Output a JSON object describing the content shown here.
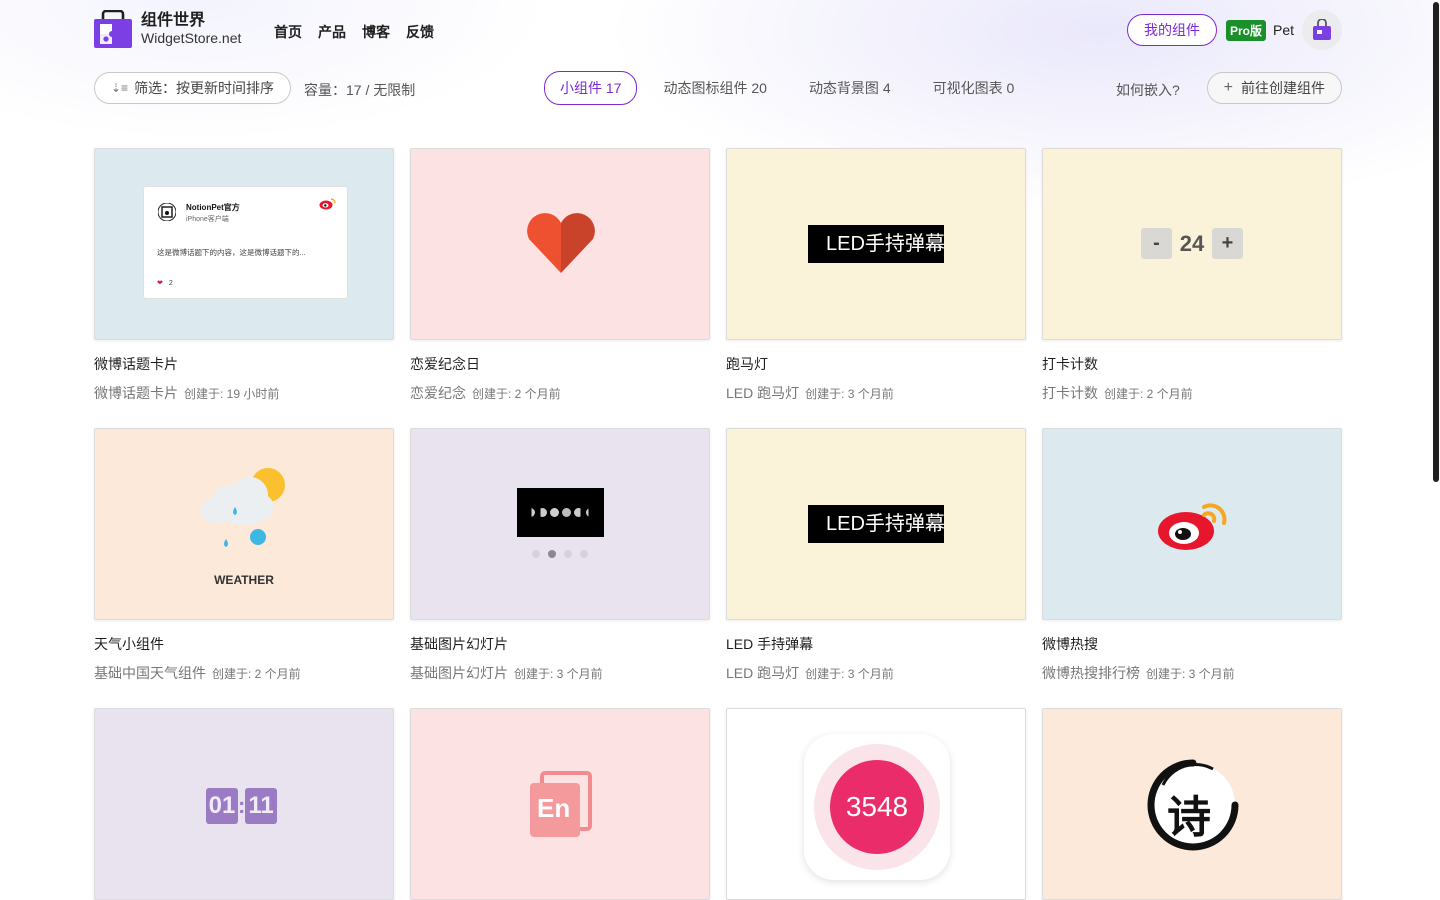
{
  "brand": {
    "title": "组件世界",
    "subtitle": "WidgetStore.net"
  },
  "nav": [
    "首页",
    "产品",
    "博客",
    "反馈"
  ],
  "header_right": {
    "my_widgets": "我的组件",
    "pro_badge": "Pro版",
    "user_name": "Pet"
  },
  "toolbar": {
    "filter_label": "筛选：按更新时间排序",
    "capacity": "容量：17 / 无限制",
    "tabs": [
      "小组件 17",
      "动态图标组件 20",
      "动态背景图 4",
      "可视化图表 0"
    ],
    "active_tab": "小组件 17",
    "embed_help": "如何嵌入?",
    "create_button": "前往创建组件"
  },
  "colors": {
    "accent": "#7b2ad6",
    "pro_green": "#1a8f2a"
  },
  "cards": [
    {
      "title": "微博话题卡片",
      "category": "微博话题卡片",
      "created": "创建于: 19 小时前",
      "preview": {
        "account": "NotionPet官方",
        "client": "iPhone客户端",
        "text": "这是微博话题下的内容，这是微博话题下的...",
        "likes": "2"
      }
    },
    {
      "title": "恋爱纪念日",
      "category": "恋爱纪念",
      "created": "创建于: 2 个月前"
    },
    {
      "title": "跑马灯",
      "category": "LED 跑马灯",
      "created": "创建于: 3 个月前",
      "preview": {
        "led_text": "LED手持弹幕"
      }
    },
    {
      "title": "打卡计数",
      "category": "打卡计数",
      "created": "创建于: 2 个月前",
      "preview": {
        "minus": "-",
        "value": "24",
        "plus": "+"
      }
    },
    {
      "title": "天气小组件",
      "category": "基础中国天气组件",
      "created": "创建于: 2 个月前",
      "preview": {
        "label": "WEATHER"
      }
    },
    {
      "title": "基础图片幻灯片",
      "category": "基础图片幻灯片",
      "created": "创建于: 3 个月前"
    },
    {
      "title": "LED 手持弹幕",
      "category": "LED 跑马灯",
      "created": "创建于: 3 个月前",
      "preview": {
        "led_text": "LED手持弹幕"
      }
    },
    {
      "title": "微博热搜",
      "category": "微博热搜排行榜",
      "created": "创建于: 3 个月前"
    },
    {
      "preview": {
        "hours": "01",
        "minutes": "11"
      }
    },
    {
      "preview": {
        "badge": "En"
      }
    },
    {
      "preview": {
        "score": "3548"
      }
    },
    {
      "preview": {
        "glyph": "诗"
      }
    }
  ]
}
